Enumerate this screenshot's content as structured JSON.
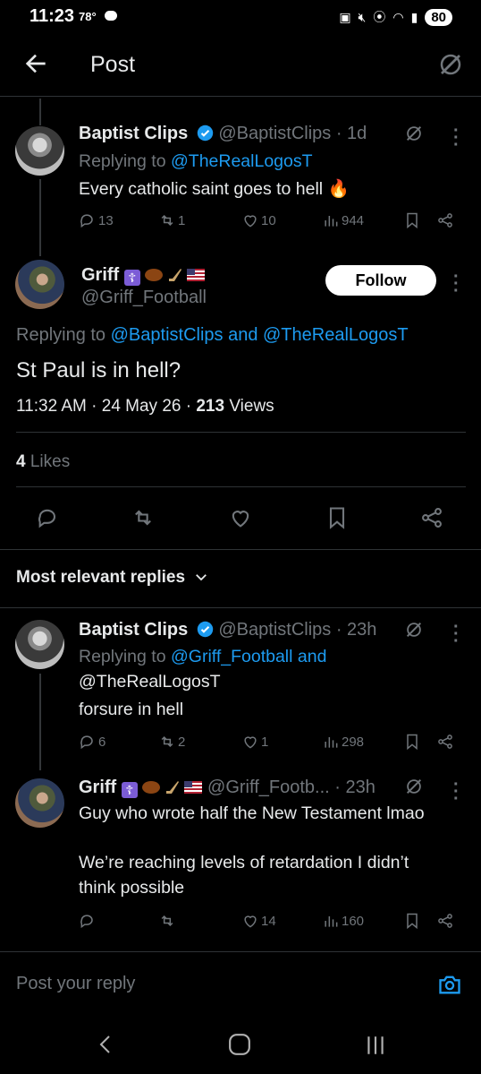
{
  "status_bar": {
    "time": "11:23",
    "temp": "78°",
    "battery": "80"
  },
  "header": {
    "title": "Post"
  },
  "parent_tweet": {
    "name": "Baptist Clips",
    "handle": "@BaptistClips",
    "time": "· 1d",
    "replying_prefix": "Replying to",
    "replying_to": "@TheRealLogosT",
    "text": "Every catholic saint goes to hell",
    "emoji": "🔥",
    "replies": "13",
    "reposts": "1",
    "likes": "10",
    "views": "944"
  },
  "main_tweet": {
    "name": "Griff",
    "handle": "@Griff_Football",
    "follow_label": "Follow",
    "replying_prefix": "Replying to",
    "replying_to": "@BaptistClips and @TheRealLogosT",
    "text": "St Paul is in hell?",
    "timestamp": "11:32 AM · 24 May 26 ·",
    "views_count": "213",
    "views_label": "Views",
    "likes_count": "4",
    "likes_label": "Likes"
  },
  "sort": {
    "label": "Most relevant replies"
  },
  "replies": [
    {
      "name": "Baptist Clips",
      "handle": "@BaptistClips",
      "time": "· 23h",
      "replying_prefix": "Replying to",
      "replying_line1": "@Griff_Football and",
      "replying_line2": "@TheRealLogosT",
      "text": "forsure in hell",
      "replies": "6",
      "reposts": "2",
      "likes": "1",
      "views": "298"
    },
    {
      "name": "Griff",
      "handle": "@Griff_Footb...",
      "time": "· 23h",
      "text_line1": "Guy who wrote half the New Testament lmao",
      "text_line2": "We’re reaching levels of retardation I didn’t",
      "text_line3": "think possible",
      "replies": "",
      "reposts": "",
      "likes": "14",
      "views": "160"
    }
  ],
  "composer": {
    "placeholder": "Post your reply"
  },
  "colors": {
    "accent": "#1d9bf0",
    "background": "#000000",
    "muted": "#71767b"
  }
}
